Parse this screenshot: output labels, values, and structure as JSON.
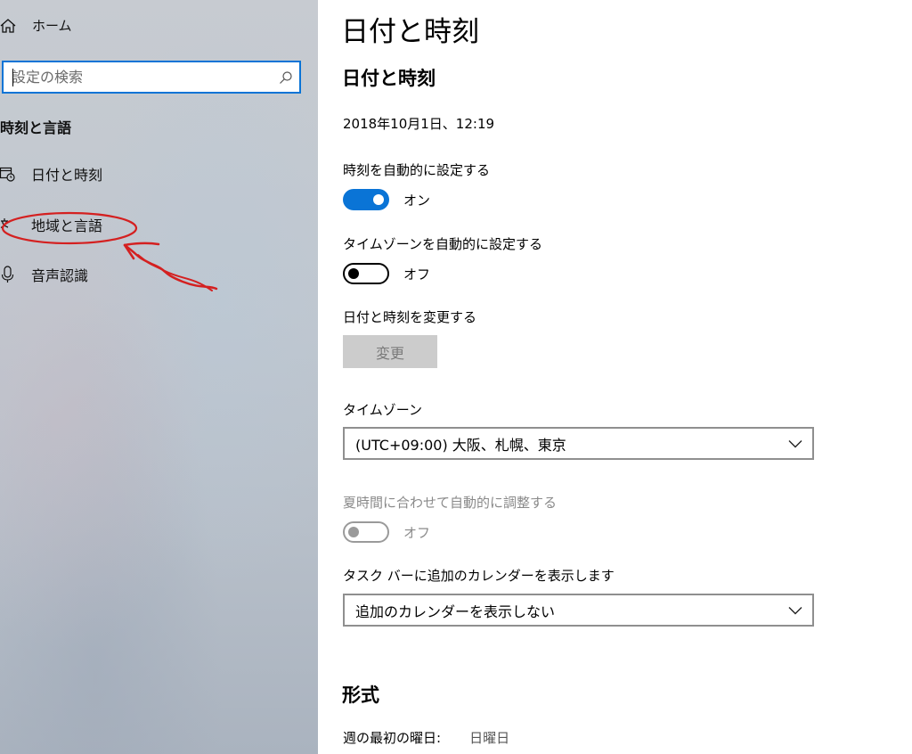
{
  "sidebar": {
    "home_label": "ホーム",
    "search_placeholder": "設定の検索",
    "section_title": "時刻と言語",
    "items": [
      {
        "label": "日付と時刻",
        "icon": "calendar-clock-icon"
      },
      {
        "label": "地域と言語",
        "icon": "region-language-icon"
      },
      {
        "label": "音声認識",
        "icon": "microphone-icon"
      }
    ]
  },
  "main": {
    "page_title": "日付と時刻",
    "section_title": "日付と時刻",
    "current_datetime": "2018年10月1日、12:19",
    "auto_time": {
      "label": "時刻を自動的に設定する",
      "state": "オン",
      "on": true
    },
    "auto_timezone": {
      "label": "タイムゾーンを自動的に設定する",
      "state": "オフ",
      "on": false
    },
    "change_datetime": {
      "label": "日付と時刻を変更する",
      "button": "変更"
    },
    "timezone": {
      "label": "タイムゾーン",
      "value": "(UTC+09:00) 大阪、札幌、東京"
    },
    "dst": {
      "label": "夏時間に合わせて自動的に調整する",
      "state": "オフ",
      "enabled": false
    },
    "taskbar_calendar": {
      "label": "タスク バーに追加のカレンダーを表示します",
      "value": "追加のカレンダーを表示しない"
    },
    "format_title": "形式",
    "first_day": {
      "label": "週の最初の曜日:",
      "value": "日曜日"
    }
  },
  "colors": {
    "accent": "#0a74d6",
    "annotation": "#d42020"
  }
}
